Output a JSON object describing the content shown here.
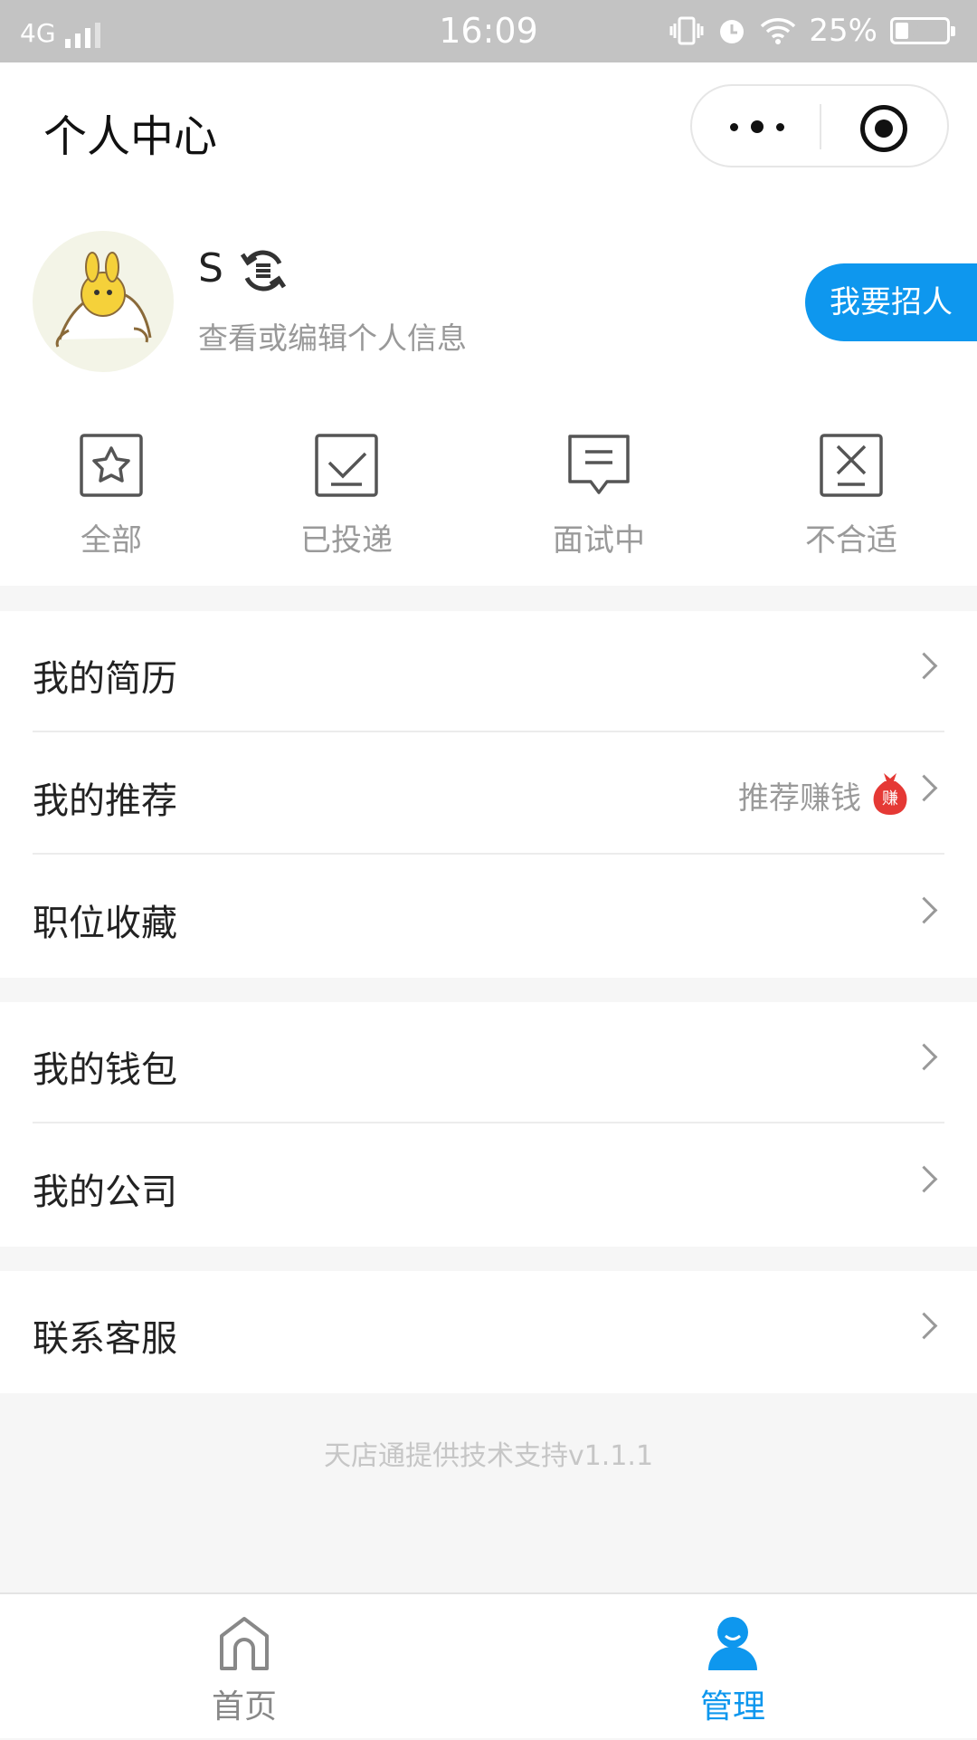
{
  "status_bar": {
    "network": "4G",
    "time": "16:09",
    "battery_percent": "25%",
    "battery_level": 0.25,
    "icons": [
      "signal-icon",
      "vibrate-icon",
      "alarm-icon",
      "wifi-icon",
      "battery-charging-icon"
    ]
  },
  "nav": {
    "title": "个人中心",
    "more_icon": "more-dots-icon",
    "close_icon": "target-close-icon"
  },
  "profile": {
    "name": "S",
    "switch_icon": "switch-role-icon",
    "edit_hint": "查看或编辑个人信息",
    "hire_button": "我要招人"
  },
  "stats": [
    {
      "label": "全部",
      "icon": "star-doc-icon"
    },
    {
      "label": "已投递",
      "icon": "check-doc-icon"
    },
    {
      "label": "面试中",
      "icon": "chat-bubble-icon"
    },
    {
      "label": "不合适",
      "icon": "x-doc-icon"
    }
  ],
  "menu_groups": [
    {
      "items": [
        {
          "label": "我的简历"
        },
        {
          "label": "我的推荐",
          "extra": "推荐赚钱",
          "badge_text": "赚",
          "badge_icon": "money-bag-icon"
        },
        {
          "label": "职位收藏"
        }
      ]
    },
    {
      "items": [
        {
          "label": "我的钱包"
        },
        {
          "label": "我的公司"
        }
      ]
    },
    {
      "items": [
        {
          "label": "联系客服"
        }
      ]
    }
  ],
  "footer": "天店通提供技术支持v1.1.1",
  "tabbar": {
    "items": [
      {
        "label": "首页",
        "icon": "home-icon",
        "active": false
      },
      {
        "label": "管理",
        "icon": "person-icon",
        "active": true
      }
    ],
    "active_color": "#0e97ee",
    "inactive_color": "#888888"
  },
  "colors": {
    "accent": "#0e97ee",
    "status_bar_bg": "#c3c3c3",
    "page_bg": "#f6f6f6"
  }
}
